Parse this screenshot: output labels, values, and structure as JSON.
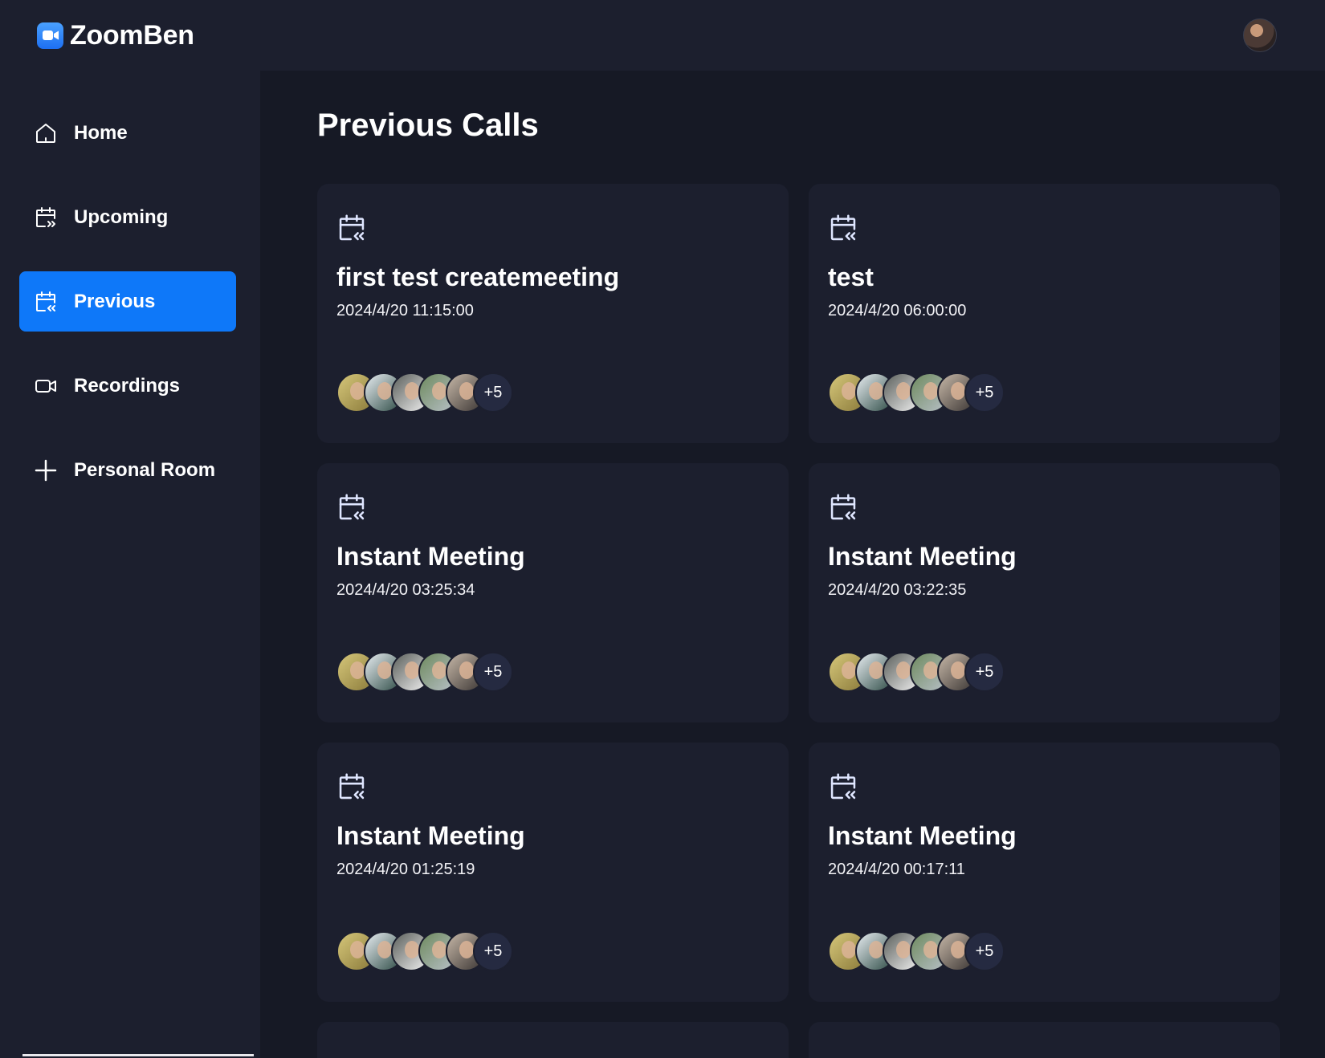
{
  "app": {
    "name": "ZoomBen"
  },
  "page": {
    "title": "Previous Calls"
  },
  "sidebar": {
    "items": [
      {
        "label": "Home",
        "icon": "home-icon",
        "active": false
      },
      {
        "label": "Upcoming",
        "icon": "calendar-upcoming-icon",
        "active": false
      },
      {
        "label": "Previous",
        "icon": "calendar-previous-icon",
        "active": true
      },
      {
        "label": "Recordings",
        "icon": "video-icon",
        "active": false
      },
      {
        "label": "Personal Room",
        "icon": "plus-icon",
        "active": false
      }
    ]
  },
  "calls": [
    {
      "title": "first test createmeeting",
      "date": "2024/4/20 11:15:00",
      "more": "+5"
    },
    {
      "title": "test",
      "date": "2024/4/20 06:00:00",
      "more": "+5"
    },
    {
      "title": "Instant Meeting",
      "date": "2024/4/20 03:25:34",
      "more": "+5"
    },
    {
      "title": "Instant Meeting",
      "date": "2024/4/20 03:22:35",
      "more": "+5"
    },
    {
      "title": "Instant Meeting",
      "date": "2024/4/20 01:25:19",
      "more": "+5"
    },
    {
      "title": "Instant Meeting",
      "date": "2024/4/20 00:17:11",
      "more": "+5"
    }
  ],
  "colors": {
    "accent": "#0e78f9",
    "sidebar": "#1c1f2e",
    "background": "#161925",
    "card": "#1c1f2e"
  }
}
